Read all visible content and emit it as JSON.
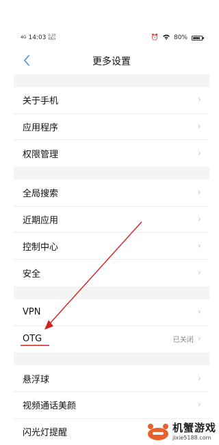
{
  "status_bar": {
    "signal": "4G",
    "time": "14:03",
    "net_speed_value": "0.20",
    "net_speed_unit": "KB/s",
    "battery": "80%",
    "battery_level": 0.8
  },
  "header": {
    "title": "更多设置",
    "back_icon": "chevron-left-icon"
  },
  "groups": [
    {
      "items": [
        {
          "label": "关于手机"
        },
        {
          "label": "应用程序"
        },
        {
          "label": "权限管理"
        }
      ]
    },
    {
      "items": [
        {
          "label": "全局搜索"
        },
        {
          "label": "近期应用"
        },
        {
          "label": "控制中心"
        },
        {
          "label": "安全"
        }
      ]
    },
    {
      "items": [
        {
          "label": "VPN"
        },
        {
          "label": "OTG",
          "value": "已关闭"
        }
      ]
    },
    {
      "items": [
        {
          "label": "悬浮球"
        },
        {
          "label": "视频通话美颜"
        },
        {
          "label": "闪光灯提醒"
        }
      ]
    }
  ],
  "colors": {
    "accent": "#4a8fe0",
    "annotation": "#d61f1f"
  },
  "watermark": {
    "title": "机蟹游戏",
    "url": "jixie5188.com"
  }
}
